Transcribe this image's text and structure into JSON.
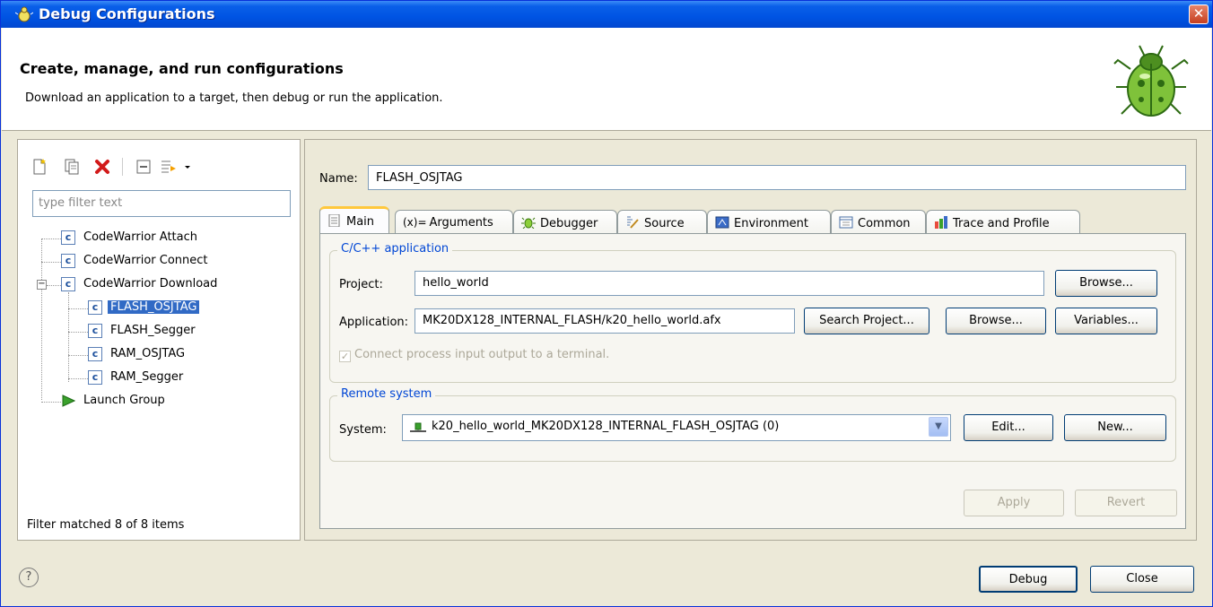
{
  "window": {
    "title": "Debug Configurations",
    "close_label": "✕"
  },
  "header": {
    "title": "Create, manage, and run configurations",
    "subtitle": "Download an application to a target, then debug or run the application."
  },
  "left": {
    "filter_placeholder": "type filter text",
    "tree": [
      {
        "label": "CodeWarrior Attach",
        "icon": "c-icon"
      },
      {
        "label": "CodeWarrior Connect",
        "icon": "c-icon"
      },
      {
        "label": "CodeWarrior Download",
        "icon": "c-icon",
        "expanded": true
      },
      {
        "label": "FLASH_OSJTAG",
        "icon": "c-icon",
        "selected": true
      },
      {
        "label": "FLASH_Segger",
        "icon": "c-icon"
      },
      {
        "label": "RAM_OSJTAG",
        "icon": "c-icon"
      },
      {
        "label": "RAM_Segger",
        "icon": "c-icon"
      },
      {
        "label": "Launch Group",
        "icon": "launch-group-icon"
      }
    ],
    "status": "Filter matched 8 of 8 items",
    "icon_char": "c"
  },
  "right": {
    "name_label": "Name:",
    "name_value": "FLASH_OSJTAG",
    "tabs": [
      "Main",
      "Arguments",
      "Debugger",
      "Source",
      "Environment",
      "Common",
      "Trace and Profile"
    ],
    "tab_arguments_prefix": "(x)=",
    "app_group": {
      "legend": "C/C++ application",
      "project_label": "Project:",
      "project_value": "hello_world",
      "browse_label": "Browse...",
      "application_label": "Application:",
      "application_value": "MK20DX128_INTERNAL_FLASH/k20_hello_world.afx",
      "search_project_label": "Search Project...",
      "browse2_label": "Browse...",
      "variables_label": "Variables...",
      "connect_checkbox_label": "Connect process input  output to a terminal."
    },
    "remote_group": {
      "legend": "Remote system",
      "system_label": "System:",
      "system_value": "k20_hello_world_MK20DX128_INTERNAL_FLASH_OSJTAG (0)",
      "edit_label": "Edit...",
      "new_label": "New..."
    },
    "apply_label": "Apply",
    "revert_label": "Revert"
  },
  "footer": {
    "help_label": "?",
    "debug_label": "Debug",
    "close_label": "Close"
  }
}
